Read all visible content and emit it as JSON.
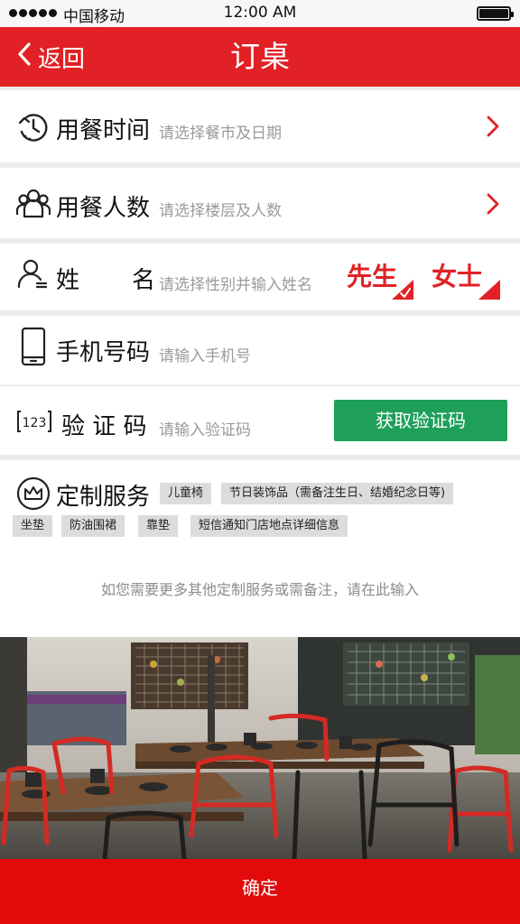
{
  "status": {
    "carrier": "中国移动",
    "time": "12:00 AM"
  },
  "nav": {
    "back_label": "返回",
    "title": "订桌"
  },
  "form": {
    "time": {
      "label": "用餐时间",
      "hint": "请选择餐市及日期",
      "icon": "clock-icon"
    },
    "guests": {
      "label": "用餐人数",
      "hint": "请选择楼层及人数",
      "icon": "people-icon"
    },
    "name": {
      "label_first": "姓",
      "label_second": "名",
      "hint": "请选择性别并输入姓名",
      "icon": "user-icon",
      "gender_options": [
        "先生",
        "女士"
      ]
    },
    "phone": {
      "label": "手机号码",
      "placeholder": "请输入手机号",
      "icon": "phone-icon"
    },
    "code": {
      "label": "验 证 码",
      "icon_text": "123",
      "placeholder": "请输入验证码",
      "button_label": "获取验证码"
    },
    "service": {
      "label": "定制服务",
      "icon": "crown-icon",
      "tags": [
        "儿童椅",
        "节日装饰品（需备注生日、结婚纪念日等)",
        "坐垫",
        "防油围裙",
        "靠垫",
        "短信通知门店地点详细信息"
      ]
    },
    "remark_placeholder": "如您需要更多其他定制服务或需备注，请在此输入"
  },
  "confirm_label": "确定",
  "colors": {
    "nav_red": "#e12125",
    "confirm_red": "#e20a0a",
    "code_button_green": "#1fa05a",
    "chevron_red": "#e12125",
    "tag_bg": "#dcdcdc"
  }
}
